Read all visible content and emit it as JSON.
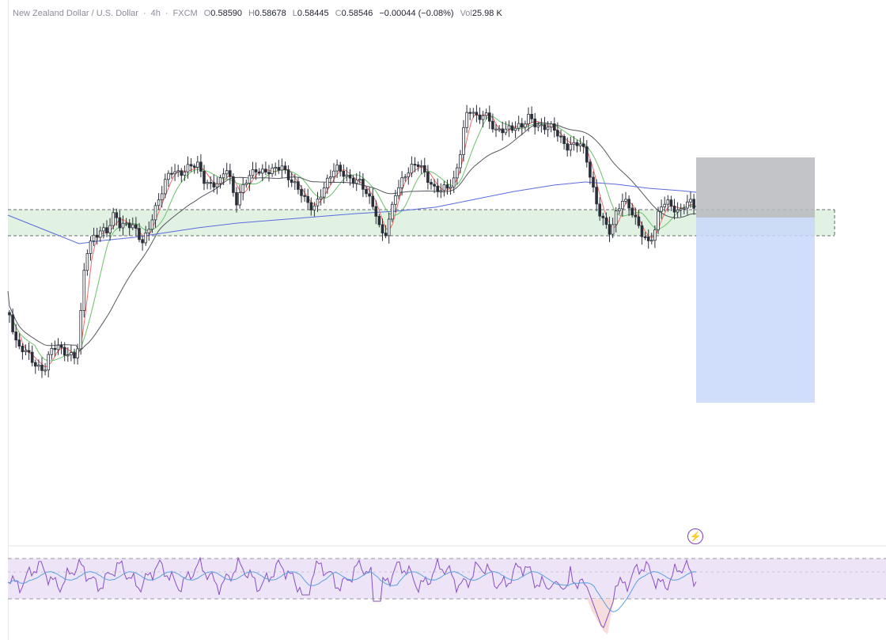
{
  "symbol": {
    "name": "New Zealand Dollar / U.S. Dollar",
    "sep1": "·",
    "interval": "4h",
    "sep2": "·",
    "source": "FXCM"
  },
  "ohlc": {
    "o_label": "O",
    "o_value": "0.58590",
    "h_label": "H",
    "h_value": "0.58678",
    "l_label": "L",
    "l_value": "0.58445",
    "c_label": "C",
    "c_value": "0.58546",
    "change": "−0.00044 (−0.08%)",
    "vol_label": "Vol",
    "vol_value": "25.98 K"
  },
  "colors": {
    "candle": "#2a2e39",
    "ma_fast": "#ef6a6a",
    "ma_mid": "#6cbf6c",
    "ma_slow": "#55585f",
    "ma_long": "#5b6be0",
    "zone_fill": "#e2f2e2",
    "stop_fill": "#b9babe",
    "target_fill": "#c8d8fa",
    "rsi_line": "#8a4fbf",
    "rsi_ma": "#5aa0e0",
    "rsi_band": "#ede5f7",
    "flash_icon": "#7b3fbf"
  },
  "icons": {
    "alert": "lightning-bolt-icon"
  },
  "chart_data": {
    "type": "candlestick",
    "overlays": [
      "moving-average-fast",
      "moving-average-mid",
      "moving-average-slow",
      "moving-average-long",
      "support-zone",
      "position-tool"
    ],
    "indicator_pane": "rsi",
    "grid": false
  }
}
